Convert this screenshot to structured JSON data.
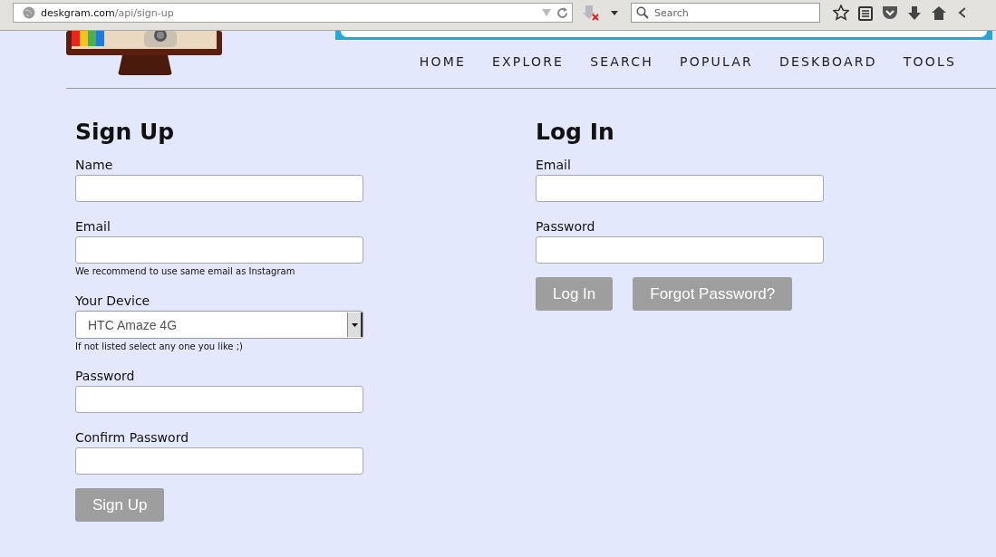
{
  "browser": {
    "url_host": "deskgram.com",
    "url_path": "/api/sign-up",
    "search_placeholder": "Search"
  },
  "nav": [
    {
      "label": "HOME"
    },
    {
      "label": "EXPLORE"
    },
    {
      "label": "SEARCH"
    },
    {
      "label": "POPULAR"
    },
    {
      "label": "DESKBOARD"
    },
    {
      "label": "TOOLS"
    }
  ],
  "signup": {
    "title": "Sign Up",
    "fields": [
      {
        "kind": "text",
        "label": "Name"
      },
      {
        "kind": "text",
        "label": "Email",
        "hint": "We recommend to use same email as Instagram"
      },
      {
        "kind": "select",
        "label": "Your Device",
        "value": "HTC Amaze 4G",
        "hint": "If not listed select any one you like ;)"
      },
      {
        "kind": "text",
        "label": "Password"
      },
      {
        "kind": "text",
        "label": "Confirm Password"
      }
    ],
    "buttons": [
      {
        "label": "Sign Up"
      }
    ]
  },
  "login": {
    "title": "Log In",
    "fields": [
      {
        "kind": "text",
        "label": "Email"
      },
      {
        "kind": "text",
        "label": "Password"
      }
    ],
    "buttons": [
      {
        "label": "Log In"
      },
      {
        "label": "Forgot Password?"
      }
    ]
  }
}
